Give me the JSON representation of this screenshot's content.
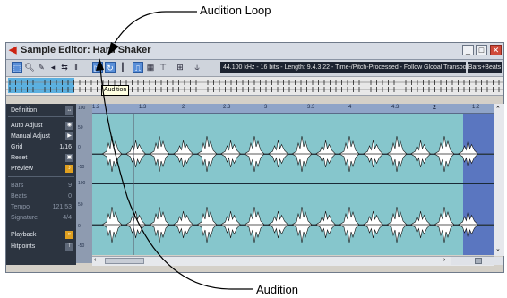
{
  "callouts": {
    "top": "Audition Loop",
    "bottom": "Audition"
  },
  "window": {
    "title": "Sample Editor: Hard Shaker",
    "buttons": {
      "minimize": "_",
      "maximize": "□",
      "close": "✕"
    }
  },
  "toolbar": {
    "info": "44.100 kHz - 16 bits - Length: 9.4.3.22 - Time-/Pitch-Processed - Follow Global Transpose",
    "mode": "Bars+Beats",
    "tooltip": "Audition"
  },
  "left_panel": {
    "definition": "Definition",
    "auto_adjust": "Auto Adjust",
    "manual_adjust": "Manual Adjust",
    "grid": {
      "label": "Grid",
      "value": "1/16"
    },
    "reset": "Reset",
    "preview": "Preview",
    "bars": {
      "label": "Bars",
      "value": "9"
    },
    "beats": {
      "label": "Beats",
      "value": "0"
    },
    "tempo": {
      "label": "Tempo",
      "value": "121.53"
    },
    "signature": {
      "label": "Signature",
      "value": "4/4"
    },
    "playback": "Playback",
    "hitpoints": "Hitpoints"
  },
  "ruler": {
    "ticks": [
      "1.2",
      "1.3",
      "2",
      "2.3",
      "3",
      "3.3",
      "4",
      "4.3",
      "2",
      "1.2"
    ]
  },
  "colors": {
    "waveform_bg": "#86c6cc",
    "loop_region": "#5a76c0",
    "overview_selection": "#5bb0e0",
    "panel_bg": "#2c3440"
  }
}
